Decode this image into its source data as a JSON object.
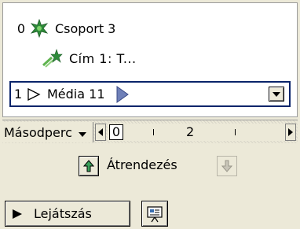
{
  "animation_list": {
    "items": [
      {
        "number": "0",
        "icon": "effect-star-icon",
        "label": "Csoport 3"
      },
      {
        "number": "",
        "icon": "effect-entrance-icon",
        "label": "Cím 1: T..."
      },
      {
        "number": "1",
        "icon": "play-trigger-icon",
        "label": "Média 11",
        "selected": true
      }
    ]
  },
  "timeline": {
    "unit_label": "Másodperc",
    "ruler_start": "0",
    "ruler_mid": "2"
  },
  "reorder": {
    "label": "Átrendezés"
  },
  "buttons": {
    "play_label": "Lejátszás"
  },
  "colors": {
    "panel_bg": "#ece9d8",
    "selection_border": "#0a246a",
    "effect_green": "#2e8b3a",
    "media_bar_blue": "#6f80b8"
  }
}
